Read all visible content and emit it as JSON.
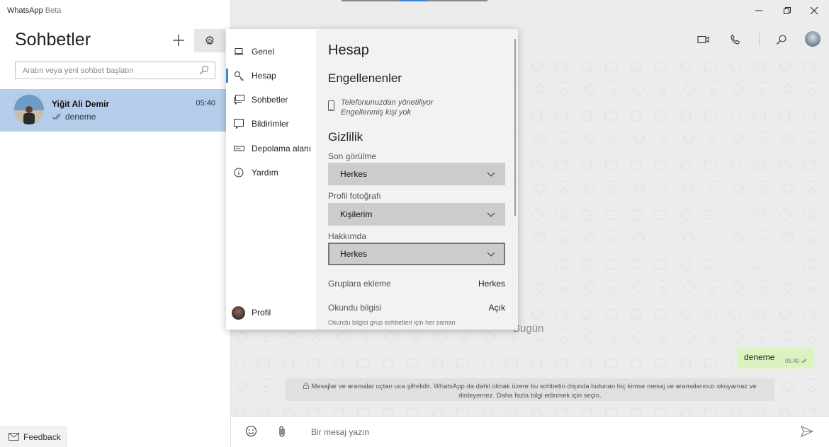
{
  "app": {
    "name": "WhatsApp",
    "badge": "Beta"
  },
  "left": {
    "title": "Sohbetler",
    "search_placeholder": "Aratın veya yeni sohbet başlatın",
    "chats": [
      {
        "name": "Yiğit Ali Demir",
        "time": "05:40",
        "preview": "deneme"
      }
    ],
    "feedback_label": "Feedback"
  },
  "settings": {
    "nav": [
      {
        "label": "Genel",
        "icon": "laptop-icon"
      },
      {
        "label": "Hesap",
        "icon": "key-icon",
        "active": true
      },
      {
        "label": "Sohbetler",
        "icon": "chat-icon"
      },
      {
        "label": "Bildirimler",
        "icon": "notification-icon"
      },
      {
        "label": "Depolama alanı",
        "icon": "storage-icon"
      },
      {
        "label": "Yardım",
        "icon": "info-icon"
      }
    ],
    "profile_label": "Profil",
    "content": {
      "title": "Hesap",
      "blocked_heading": "Engellenenler",
      "blocked_line1": "Telefonunuzdan yönetiliyor",
      "blocked_line2": "Engellenmiş kişi yok",
      "privacy_heading": "Gizlilik",
      "last_seen_label": "Son görülme",
      "last_seen_value": "Herkes",
      "profile_photo_label": "Profil fotoğrafı",
      "profile_photo_value": "Kişilerim",
      "about_label": "Hakkımda",
      "about_value": "Herkes",
      "groups_label": "Gruplara ekleme",
      "groups_value": "Herkes",
      "receipts_label": "Okundu bilgisi",
      "receipts_value": "Açık",
      "receipts_note": "Okundu bilgisi grup sohbetleri için her zaman"
    }
  },
  "conversation": {
    "date_label": "Bugün",
    "messages": [
      {
        "text": "deneme",
        "time": "05:40"
      }
    ],
    "encryption_notice": "Mesajlar ve aramalar uçtan uca şifrelidir. WhatsApp da dahil olmak üzere bu sohbetin dışında bulunan hiç kimse mesaj ve aramalarınızı okuyamaz ve dinleyemez. Daha fazla bilgi edinmek için seçin.",
    "composer_placeholder": "Bir mesaj yazın"
  },
  "colors": {
    "accent": "#3a86d4",
    "selected_chat": "#b3cdea",
    "outgoing_bubble": "#dcf3c0",
    "chat_background": "#ececec"
  }
}
